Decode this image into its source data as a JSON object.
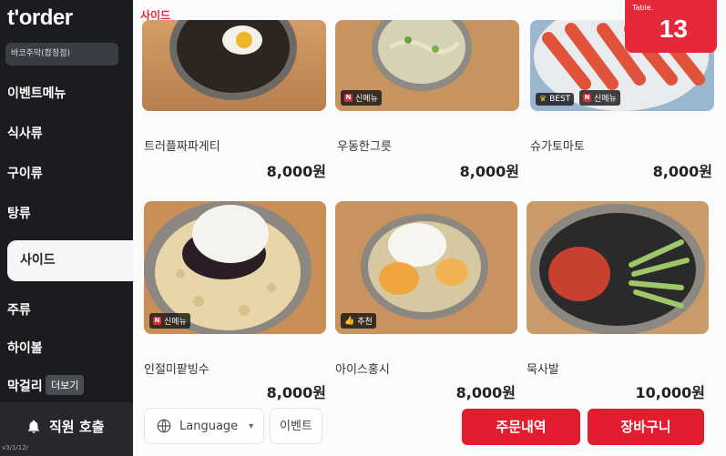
{
  "brand": {
    "logo": "t'order",
    "store_name": "바코주막(합정점)"
  },
  "sidebar": {
    "items": [
      {
        "label": "이벤트메뉴",
        "active": false
      },
      {
        "label": "식사류",
        "active": false
      },
      {
        "label": "구이류",
        "active": false
      },
      {
        "label": "탕류",
        "active": false
      },
      {
        "label": "사이드",
        "active": true
      },
      {
        "label": "주류",
        "active": false
      },
      {
        "label": "하이볼",
        "active": false
      },
      {
        "label": "막걸리",
        "active": false
      }
    ],
    "more_label": "더보기",
    "call_staff": "직원 호출",
    "version": "v3/1/12/"
  },
  "section": {
    "title": "사이드"
  },
  "table": {
    "label": "Table.",
    "number": "13"
  },
  "menu": [
    {
      "name": "트러플짜파게티",
      "price": "8,000원",
      "badges": []
    },
    {
      "name": "우동한그릇",
      "price": "8,000원",
      "badges": [
        {
          "type": "new",
          "label": "신메뉴"
        }
      ]
    },
    {
      "name": "슈가토마토",
      "price": "8,000원",
      "badges": [
        {
          "type": "best",
          "label": "BEST"
        },
        {
          "type": "new",
          "label": "신메뉴"
        }
      ]
    },
    {
      "name": "인절미팥빙수",
      "price": "8,000원",
      "badges": [
        {
          "type": "new",
          "label": "신메뉴"
        }
      ]
    },
    {
      "name": "아이스홍시",
      "price": "8,000원",
      "badges": [
        {
          "type": "recommend",
          "label": "추천"
        }
      ]
    },
    {
      "name": "묵사발",
      "price": "10,000원",
      "badges": []
    }
  ],
  "bottom": {
    "language": "Language",
    "event": "이벤트",
    "order_history": "주문내역",
    "cart": "장바구니"
  },
  "colors": {
    "accent": "#e31d2f",
    "sidebar_bg": "#1b1c1f"
  }
}
